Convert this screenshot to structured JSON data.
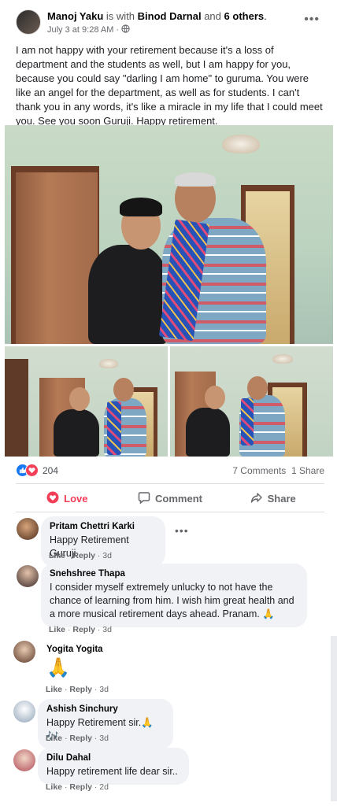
{
  "post": {
    "author": "Manoj Yaku",
    "with_text": "is with",
    "tagged": "Binod Darnal",
    "and_text": "and",
    "others": "6 others",
    "period": ".",
    "date": "July 3 at 9:28 AM",
    "date_sep": "·",
    "more_icon": "more-dots-icon",
    "body": "I am not happy with your retirement because it's a loss of department and the students as well, but I am happy for you, because you could say \"darling I am home\" to guruma. You were like an angel for the department, as well as for students. I can't thank you in any words, it's like a miracle in my life that I could meet you. See you soon Guruji. Happy retirement."
  },
  "stats": {
    "reaction_count": "204",
    "comments": "7 Comments",
    "shares": "1 Share"
  },
  "actions": {
    "love": "Love",
    "comment": "Comment",
    "share": "Share"
  },
  "colors": {
    "love_accent": "#f33e58",
    "like_blue": "#1877f2",
    "meta_gray": "#65676b",
    "bubble_bg": "#f0f2f5"
  },
  "comments": [
    {
      "name": "Pritam Chettri Karki",
      "text": "Happy Retirement Guruji",
      "like": "Like",
      "sep": "·",
      "reply": "Reply",
      "time": "3d"
    },
    {
      "name": "Snehshree Thapa",
      "text": "I consider myself extremely unlucky to not have the chance of learning from him. I wish him great health and a more musical retirement days ahead. Pranam. 🙏",
      "like": "Like",
      "sep": "·",
      "reply": "Reply",
      "time": "3d"
    },
    {
      "name": "Yogita Yogita",
      "text": "🙏",
      "like": "Like",
      "sep": "·",
      "reply": "Reply",
      "time": "3d"
    },
    {
      "name": "Ashish Sinchury",
      "text": "Happy Retirement sir.🙏🎶",
      "like": "Like",
      "sep": "·",
      "reply": "Reply",
      "time": "3d"
    },
    {
      "name": "Dilu Dahal",
      "text": "Happy retirement life dear sir..",
      "like": "Like",
      "sep": "·",
      "reply": "Reply",
      "time": "2d"
    }
  ]
}
